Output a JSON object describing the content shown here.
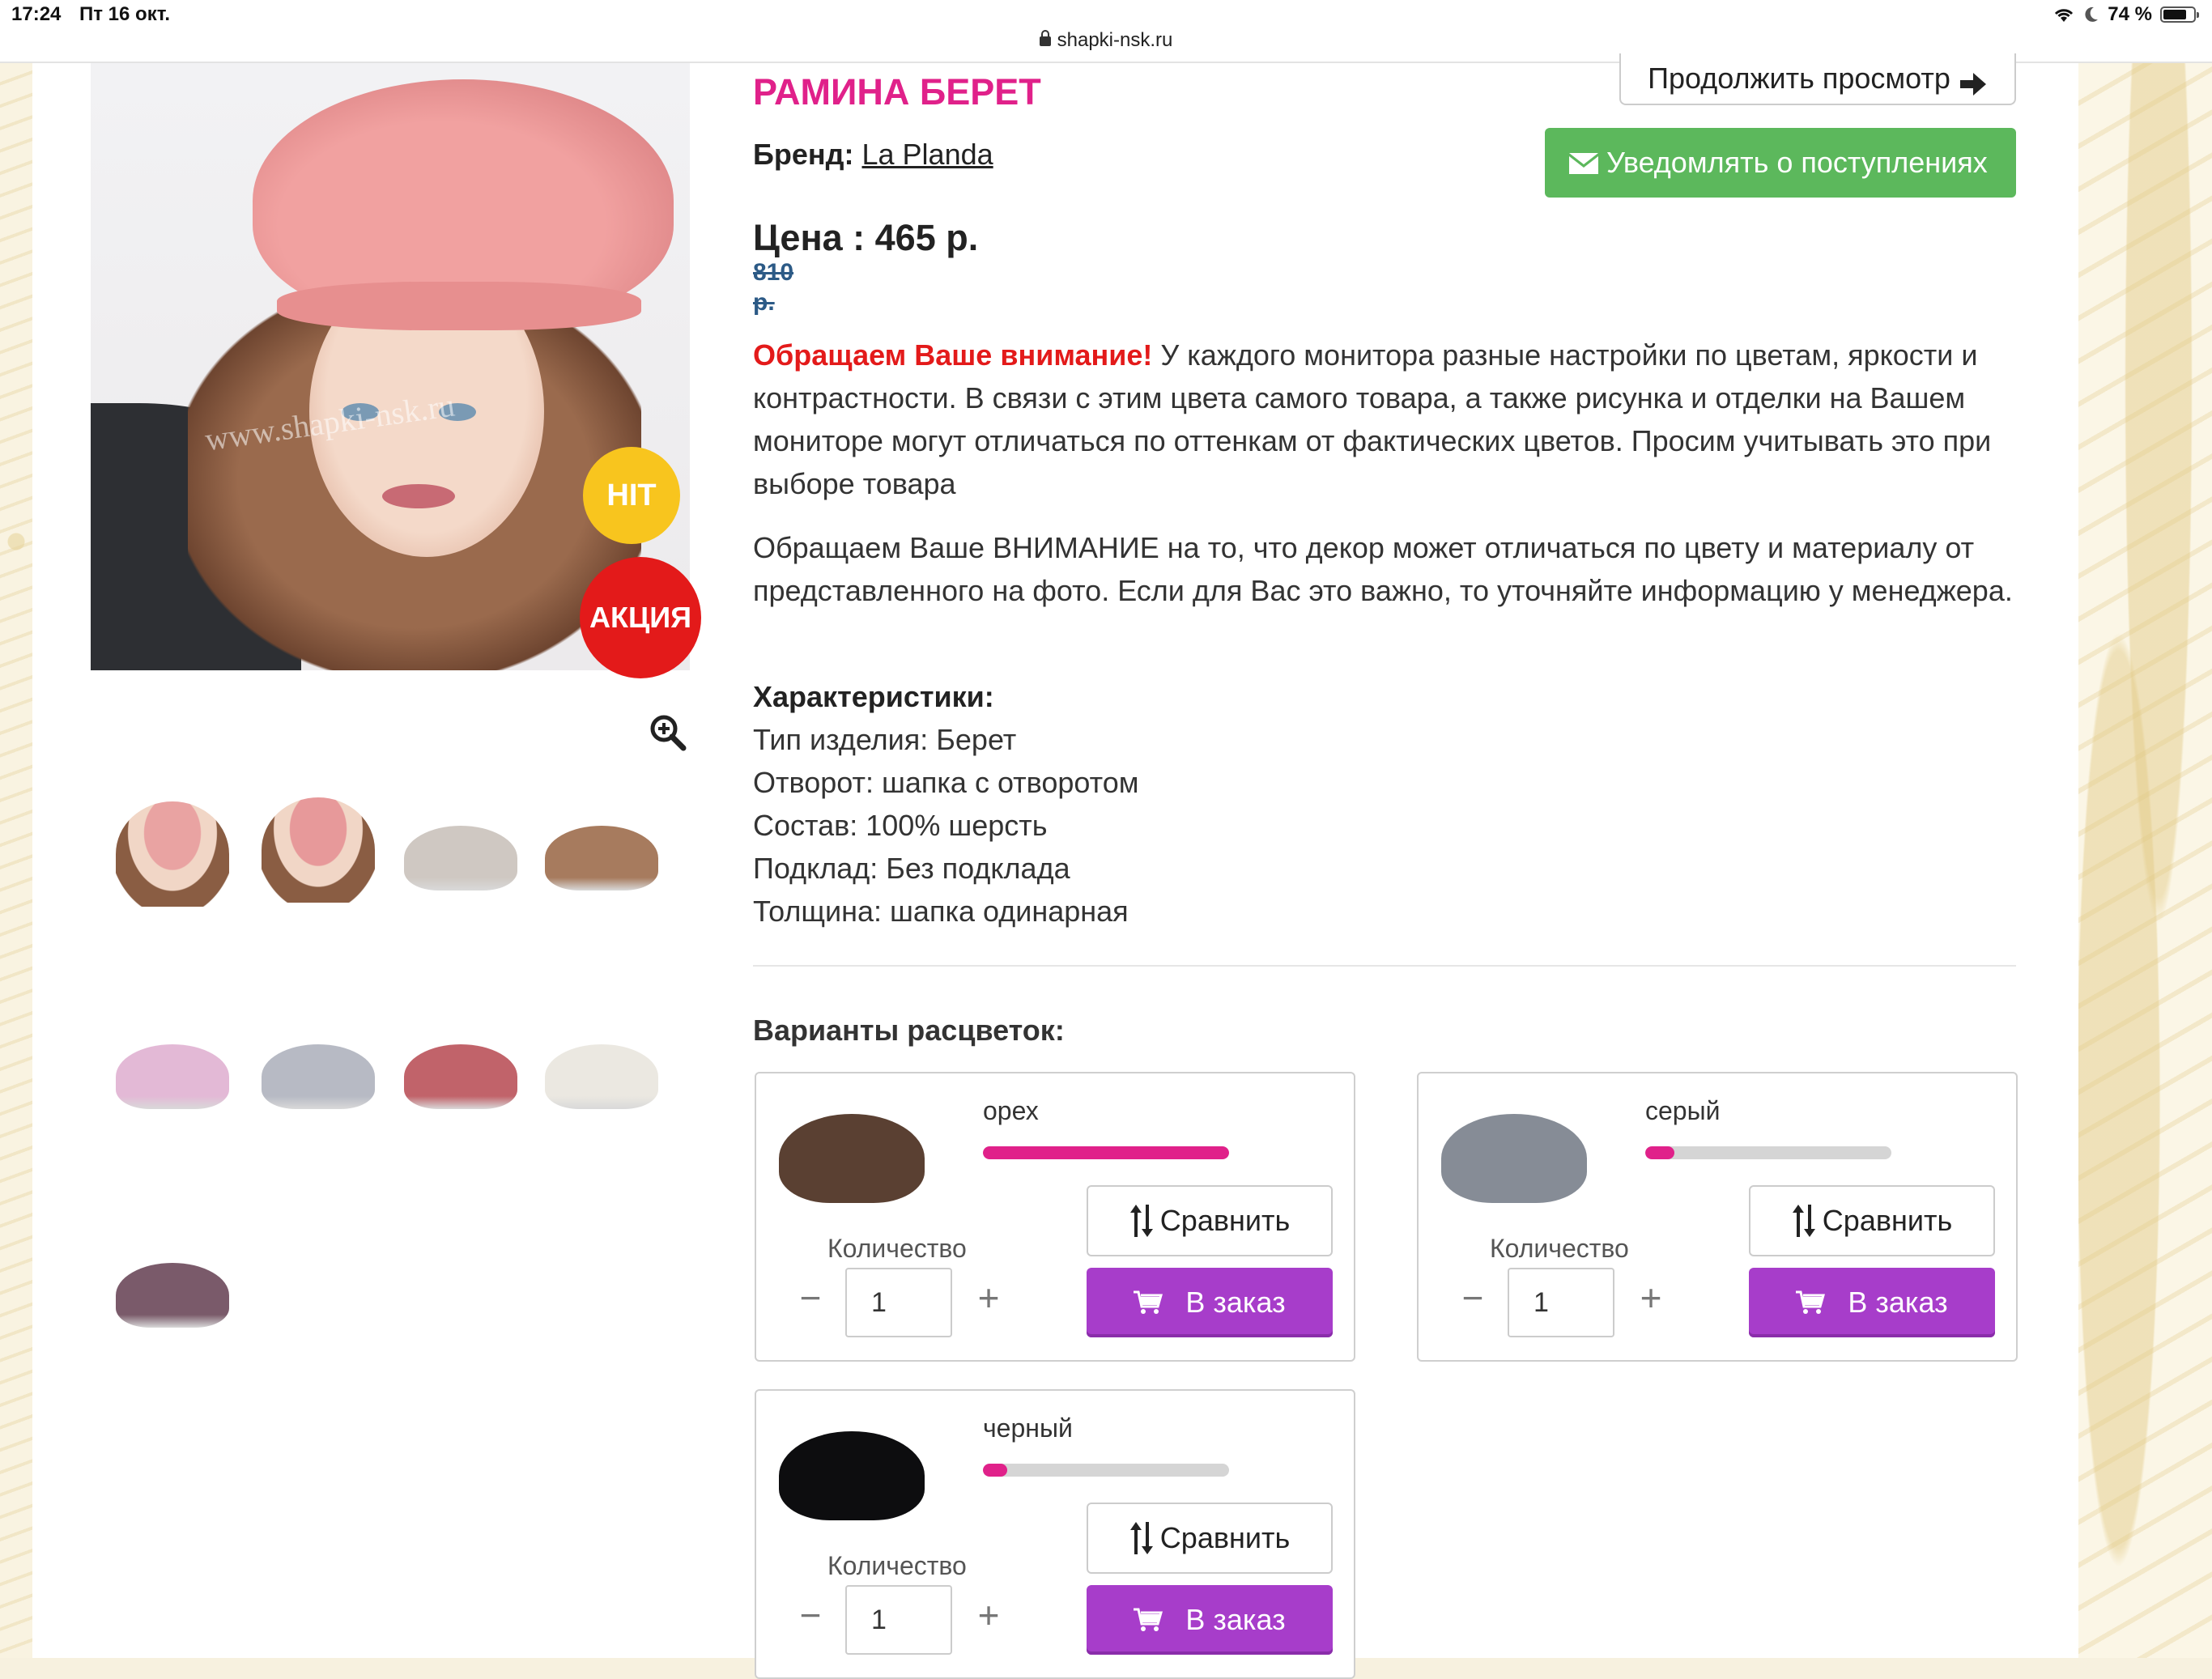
{
  "statusbar": {
    "time": "17:24",
    "date": "Пт 16 окт.",
    "url": "shapki-nsk.ru",
    "battery": "74 %"
  },
  "gallery": {
    "badge_hit": "HIT",
    "badge_sale": "АКЦИЯ",
    "watermark": "www.shapki-nsk.ru",
    "thumbnail_colors": [
      "#e9a3a2",
      "#e7999a",
      "#cfc8c2",
      "#a77b5e",
      "#e3b9d6",
      "#b7bac4",
      "#c1636a",
      "#ebe8e1",
      "#7a5a6a"
    ]
  },
  "product": {
    "title": "РАМИНА БЕРЕТ",
    "continue_label": "Продолжить просмотр",
    "brand_label": "Бренд:",
    "brand_name": "La Planda",
    "notify_label": "Уведомлять о поступлениях",
    "price": "Цена : 465 р.",
    "old_price_value": "810",
    "old_price_currency": "р.",
    "notice_warn": "Обращаем Ваше внимание!",
    "notice_text": " У каждого монитора разные настройки по цветам, яркости и контрастности. В связи с этим цвета самого товара, а также рисунка и отделки на Вашем мониторе могут отличаться по оттенкам от фактических цветов. Просим учитывать это при выборе товара",
    "decor_notice": "Обращаем Ваше ВНИМАНИЕ на то, что декор может отличаться по цвету и материалу от представленного на фото. Если для Вас это важно, то уточняйте информацию у менеджера.",
    "characteristics_title": "Характеристики:",
    "characteristics": [
      "Тип изделия: Берет",
      "Отворот: шапка с отворотом",
      "Состав: 100% шерсть",
      "Подклад: Без подклада",
      "Толщина: шапка одинарная"
    ]
  },
  "variants": {
    "title": "Варианты расцветок:",
    "compare_label": "Сравнить",
    "qty_label": "Количество",
    "order_label": "В заказ",
    "items": [
      {
        "name": "орех",
        "qty": "1",
        "stock": 1.0,
        "color": "#5a4032"
      },
      {
        "name": "серый",
        "qty": "1",
        "stock": 0.12,
        "color": "#868c96"
      },
      {
        "name": "черный",
        "qty": "1",
        "stock": 0.1,
        "color": "#0d0d0f"
      }
    ]
  },
  "accent_colors": {
    "title": "#e0218a",
    "notify": "#5cb85c",
    "order": "#a73dca",
    "warn": "#e31a1a",
    "hit": "#f8c51e"
  }
}
